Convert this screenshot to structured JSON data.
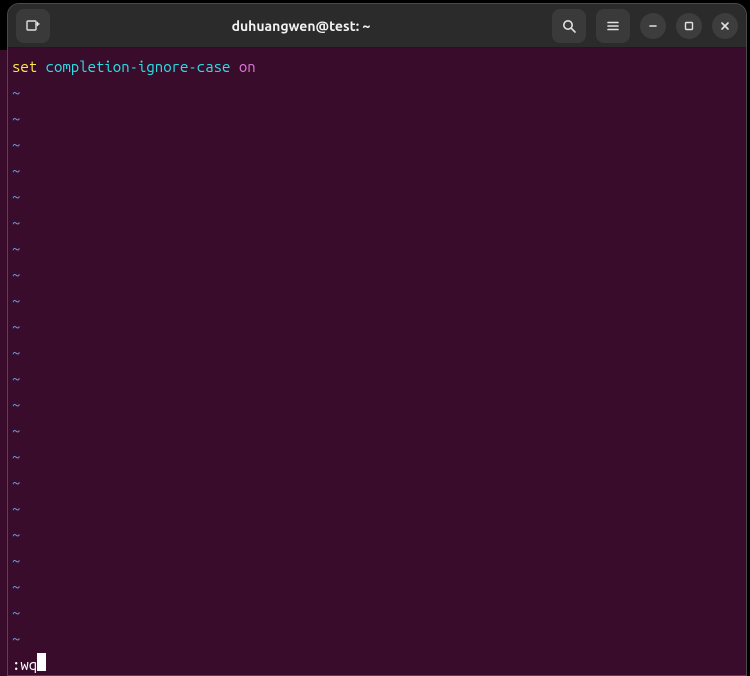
{
  "window": {
    "title": "duhuangwen@test: ~"
  },
  "editor": {
    "content_line": {
      "keyword": "set",
      "option": "completion-ignore-case",
      "value": "on"
    },
    "tilde_char": "~",
    "tilde_count": 22,
    "command_line": ":wq"
  },
  "icons": {
    "new_tab": "new-tab-icon",
    "search": "search-icon",
    "menu": "hamburger-icon",
    "minimize": "minimize-icon",
    "maximize": "maximize-icon",
    "close": "close-icon"
  },
  "colors": {
    "terminal_bg": "#380c2a",
    "keyword": "#fde94f",
    "option": "#29e0e6",
    "value": "#d977d8",
    "tilde": "#6a9fe8"
  }
}
